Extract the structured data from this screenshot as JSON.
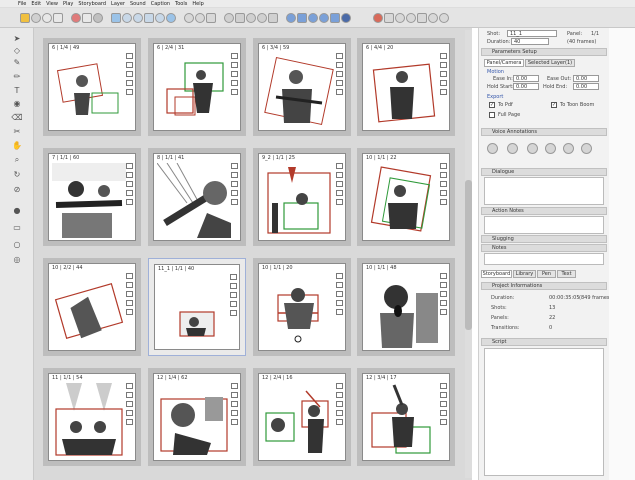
{
  "menu": [
    "File",
    "Edit",
    "View",
    "Play",
    "Storyboard",
    "Layer",
    "Sound",
    "Caption",
    "Tools",
    "Help"
  ],
  "panels": [
    {
      "label": "6 | 1/4 | 49",
      "row": 0,
      "col": 0
    },
    {
      "label": "6 | 2/4 | 31",
      "row": 0,
      "col": 1
    },
    {
      "label": "6 | 3/4 | 59",
      "row": 0,
      "col": 2
    },
    {
      "label": "6 | 4/4 | 20",
      "row": 0,
      "col": 3
    },
    {
      "label": "7 | 1/1 | 60",
      "row": 1,
      "col": 0
    },
    {
      "label": "8 | 1/1 | 41",
      "row": 1,
      "col": 1
    },
    {
      "label": "9_2 | 1/1 | 25",
      "row": 1,
      "col": 2
    },
    {
      "label": "10 | 1/1 | 22",
      "row": 1,
      "col": 3
    },
    {
      "label": "10 | 2/2 | 44",
      "row": 2,
      "col": 0
    },
    {
      "label": "11_1 | 1/1 | 40",
      "row": 2,
      "col": 1
    },
    {
      "label": "10 | 1/1 | 20",
      "row": 2,
      "col": 2
    },
    {
      "label": "10 | 1/1 | 48",
      "row": 2,
      "col": 3
    },
    {
      "label": "11 | 1/1 | 54",
      "row": 3,
      "col": 0
    },
    {
      "label": "12 | 1/4 | 62",
      "row": 3,
      "col": 1
    },
    {
      "label": "12 | 2/4 | 16",
      "row": 3,
      "col": 2
    },
    {
      "label": "12 | 3/4 | 17",
      "row": 3,
      "col": 3
    }
  ],
  "right": {
    "shot_label": "Shot:",
    "shot_value": "11_1",
    "panel_label": "Panel:",
    "panel_value": "1/1",
    "duration_label": "Duration:",
    "duration_value": "40",
    "duration_frames": "(40 frames)",
    "parameters_title": "Parameters Setup",
    "tab_panel": "Panel/Camera",
    "tab_layers": "Selected Layer(1)",
    "motion_title": "Motion",
    "ease_in": "Ease In:",
    "ease_out": "Ease Out:",
    "hold_start": "Hold Start:",
    "hold_end": "Hold End:",
    "zero": "0.00",
    "export_title": "Export",
    "to_pdf": "To Pdf",
    "to_toon_boom": "To Toon Boom",
    "full_page": "Full Page",
    "voice_title": "Voice Annotations",
    "dialogue": "Dialogue",
    "action_notes": "Action Notes",
    "slugging": "Slugging",
    "notes": "Notes",
    "tabs": [
      "Storyboard",
      "Library",
      "Pen",
      "Text"
    ],
    "project_title": "Project Informations",
    "p_duration_label": "Duration:",
    "p_duration_value": "00:00:35:05",
    "p_duration_frames": "(849 frames)",
    "p_shots_label": "Shots:",
    "p_shots_value": "13",
    "p_panels_label": "Panels:",
    "p_panels_value": "22",
    "p_transitions_label": "Transitions:",
    "p_transitions_value": "0",
    "script_title": "Script"
  },
  "colors": {
    "accent_red": "#b23a2a",
    "accent_green": "#2f9a3a",
    "selection": "#9fb0d8"
  }
}
